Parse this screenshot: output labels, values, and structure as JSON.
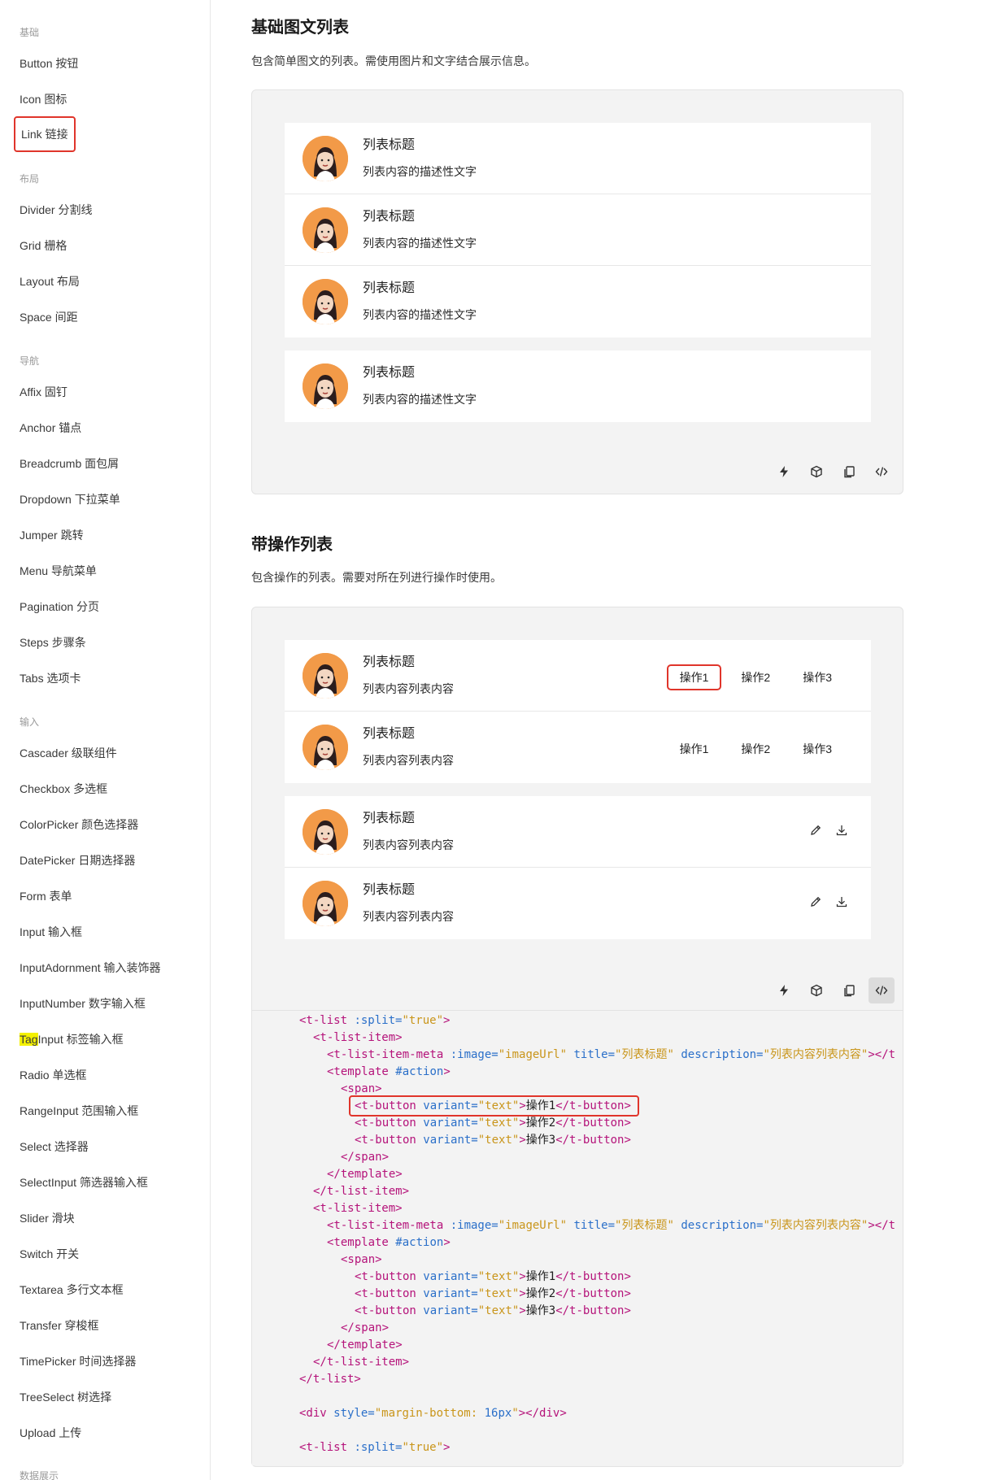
{
  "sidebar": {
    "groups": [
      "基础",
      "布局",
      "导航",
      "输入",
      "数据展示"
    ],
    "items": [
      {
        "label": "Button 按钮"
      },
      {
        "label": "Icon 图标"
      },
      {
        "label": "Link 链接"
      },
      {
        "label": "Divider 分割线"
      },
      {
        "label": "Grid 栅格"
      },
      {
        "label": "Layout 布局"
      },
      {
        "label": "Space 间距"
      },
      {
        "label": "Affix 固钉"
      },
      {
        "label": "Anchor 锚点"
      },
      {
        "label": "Breadcrumb 面包屑"
      },
      {
        "label": "Dropdown 下拉菜单"
      },
      {
        "label": "Jumper 跳转"
      },
      {
        "label": "Menu 导航菜单"
      },
      {
        "label": "Pagination 分页"
      },
      {
        "label": "Steps 步骤条"
      },
      {
        "label": "Tabs 选项卡"
      },
      {
        "label": "Cascader 级联组件"
      },
      {
        "label": "Checkbox 多选框"
      },
      {
        "label": "ColorPicker 颜色选择器"
      },
      {
        "label": "DatePicker 日期选择器"
      },
      {
        "label": "Form 表单"
      },
      {
        "label": "Input 输入框"
      },
      {
        "label": "InputAdornment 输入装饰器"
      },
      {
        "label": "InputNumber 数字输入框"
      },
      {
        "label": "TagInput 标签输入框",
        "highlight": "Tag",
        "rest": "Input 标签输入框"
      },
      {
        "label": "Radio 单选框"
      },
      {
        "label": "RangeInput 范围输入框"
      },
      {
        "label": "Select 选择器"
      },
      {
        "label": "SelectInput 筛选器输入框"
      },
      {
        "label": "Slider 滑块"
      },
      {
        "label": "Switch 开关"
      },
      {
        "label": "Textarea 多行文本框"
      },
      {
        "label": "Transfer 穿梭框"
      },
      {
        "label": "TimePicker 时间选择器"
      },
      {
        "label": "TreeSelect 树选择"
      },
      {
        "label": "Upload 上传"
      }
    ],
    "active_item": "Link 链接",
    "highlight_color": "#f4f100",
    "annotation_color": "#e0352b"
  },
  "section1": {
    "title": "基础图文列表",
    "desc": "包含简单图文的列表。需使用图片和文字结合展示信息。",
    "rows": [
      {
        "title": "列表标题",
        "desc": "列表内容的描述性文字"
      },
      {
        "title": "列表标题",
        "desc": "列表内容的描述性文字"
      },
      {
        "title": "列表标题",
        "desc": "列表内容的描述性文字"
      },
      {
        "title": "列表标题",
        "desc": "列表内容的描述性文字"
      }
    ]
  },
  "section2": {
    "title": "带操作列表",
    "desc": "包含操作的列表。需要对所在列进行操作时使用。",
    "rows": [
      {
        "title": "列表标题",
        "desc": "列表内容列表内容",
        "actions": [
          "操作1",
          "操作2",
          "操作3"
        ]
      },
      {
        "title": "列表标题",
        "desc": "列表内容列表内容",
        "actions": [
          "操作1",
          "操作2",
          "操作3"
        ]
      },
      {
        "title": "列表标题",
        "desc": "列表内容列表内容",
        "icons": [
          "edit-icon",
          "download-icon"
        ]
      },
      {
        "title": "列表标题",
        "desc": "列表内容列表内容",
        "icons": [
          "edit-icon",
          "download-icon"
        ]
      }
    ]
  },
  "toolbar": {
    "icons": [
      "lightning-icon",
      "cube-icon",
      "copy-icon",
      "code-icon"
    ]
  },
  "code": {
    "l1_a": "<t-list ",
    "l1_b": ":split=",
    "l1_c": "\"true\"",
    "l1_d": ">",
    "l2": "<t-list-item>",
    "l3_a": "<t-list-item-meta ",
    "l3_b": ":image=",
    "l3_c": "\"imageUrl\"",
    "l3_d": " title=",
    "l3_e": "\"列表标题\"",
    "l3_f": " description=",
    "l3_g": "\"列表内容列表内容\"",
    "l3_h": "></t",
    "l4_a": "<template ",
    "l4_b": "#action",
    "l4_c": ">",
    "l5": "<span>",
    "btn_a": "<t-button ",
    "btn_b": "variant=",
    "btn_c": "\"text\"",
    "btn_d": ">",
    "btn1": "操作1",
    "btn2": "操作2",
    "btn3": "操作3",
    "btn_close": "</t-button>",
    "l9": "</span>",
    "l10": "</template>",
    "l11": "</t-list-item>",
    "l20": "</t-list>",
    "l22_a": "<div ",
    "l22_b": "style=",
    "l22_c": "\"margin-bottom: ",
    "l22_d": "16px",
    "l22_e": "\"",
    "l22_f": "></div>",
    "l24_a": "<t-list ",
    "l24_b": ":split=",
    "l24_c": "\"true\"",
    "l24_d": ">"
  }
}
